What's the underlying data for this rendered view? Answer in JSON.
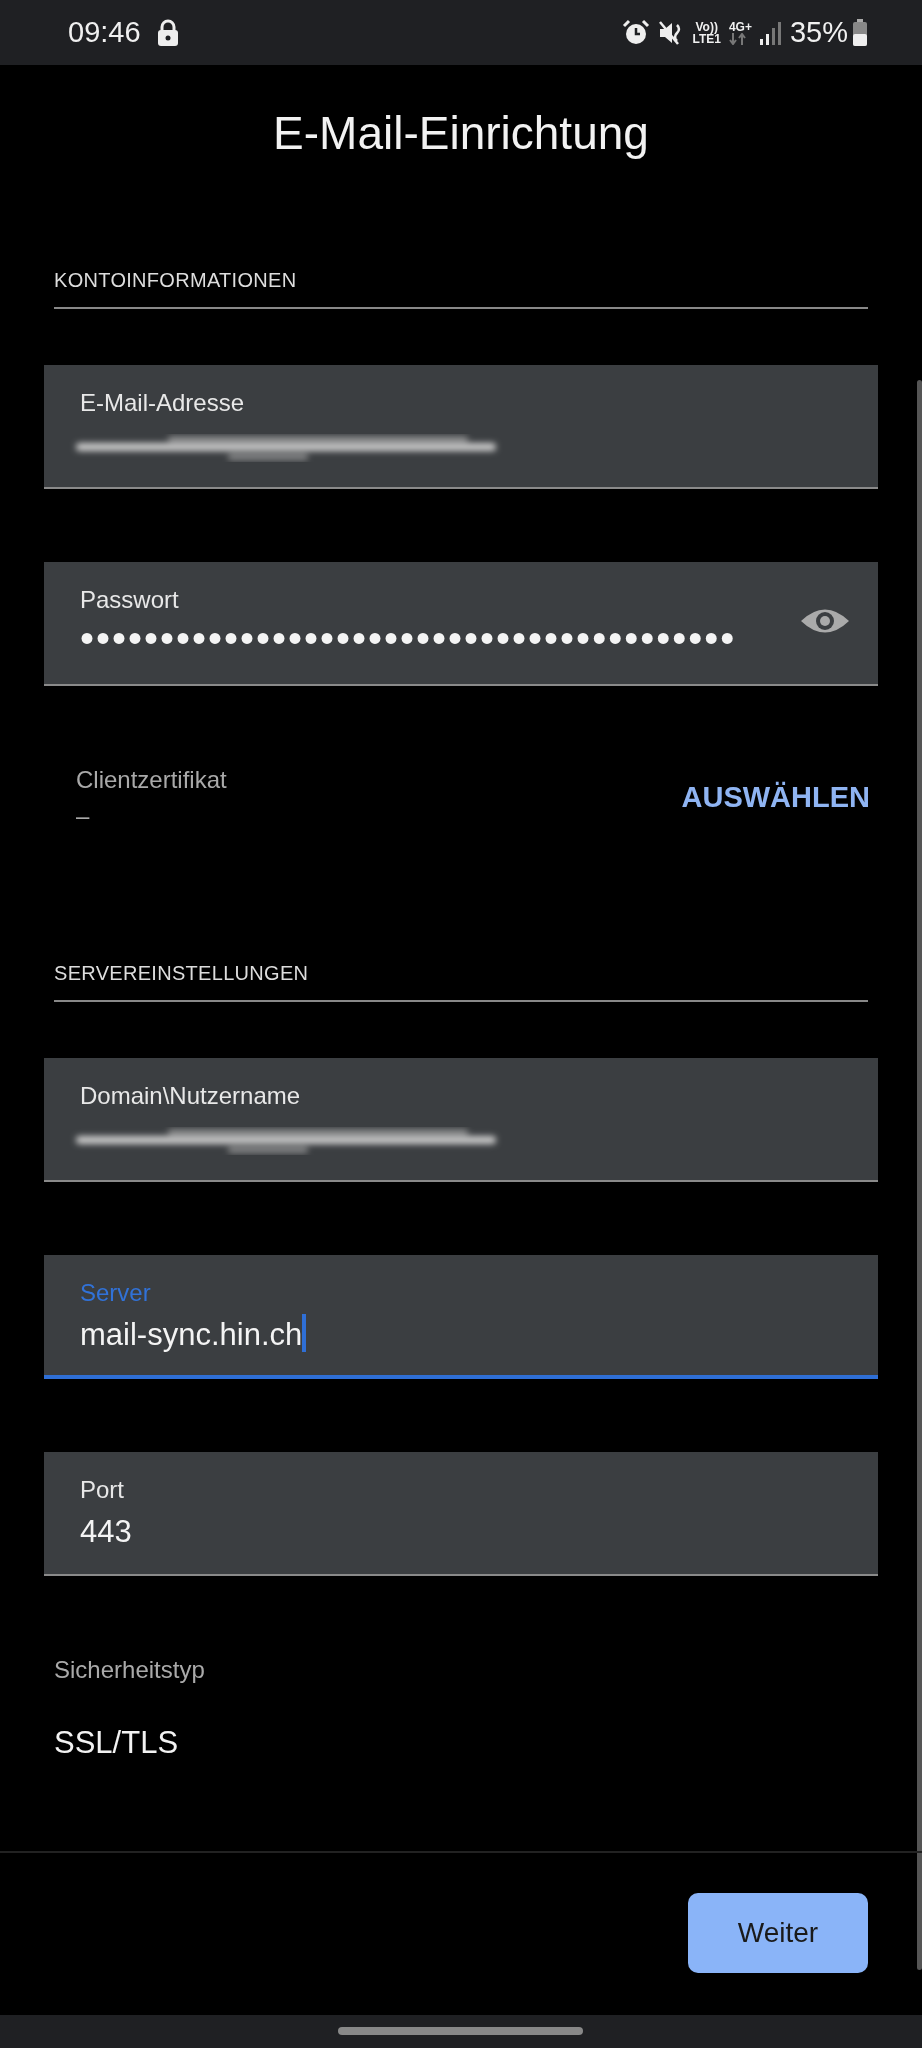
{
  "status_bar": {
    "time": "09:46",
    "volte": "Vo))",
    "volte_sub": "LTE1",
    "network": "4G+",
    "battery": "35%"
  },
  "title": "E-Mail-Einrichtung",
  "sections": [
    {
      "heading": "KONTOINFORMATIONEN",
      "items": [
        {
          "kind": "blurred",
          "label": "E-Mail-Adresse",
          "focused": false
        },
        {
          "kind": "password",
          "label": "Passwort",
          "value": "•••••••••••••••••••••••••••••••••••••••••",
          "focused": false
        },
        {
          "kind": "picker",
          "label": "Clientzertifikat",
          "value": "–",
          "action": "AUSWÄHLEN"
        }
      ]
    },
    {
      "heading": "SERVEREINSTELLUNGEN",
      "items": [
        {
          "kind": "blurred",
          "label": "Domain\\Nutzername",
          "focused": false
        },
        {
          "kind": "text",
          "label": "Server",
          "value": "mail-sync.hin.ch",
          "focused": true
        },
        {
          "kind": "text",
          "label": "Port",
          "value": "443",
          "focused": false
        },
        {
          "kind": "static",
          "label": "Sicherheitstyp",
          "value": "SSL/TLS"
        }
      ]
    }
  ],
  "next_button": "Weiter"
}
